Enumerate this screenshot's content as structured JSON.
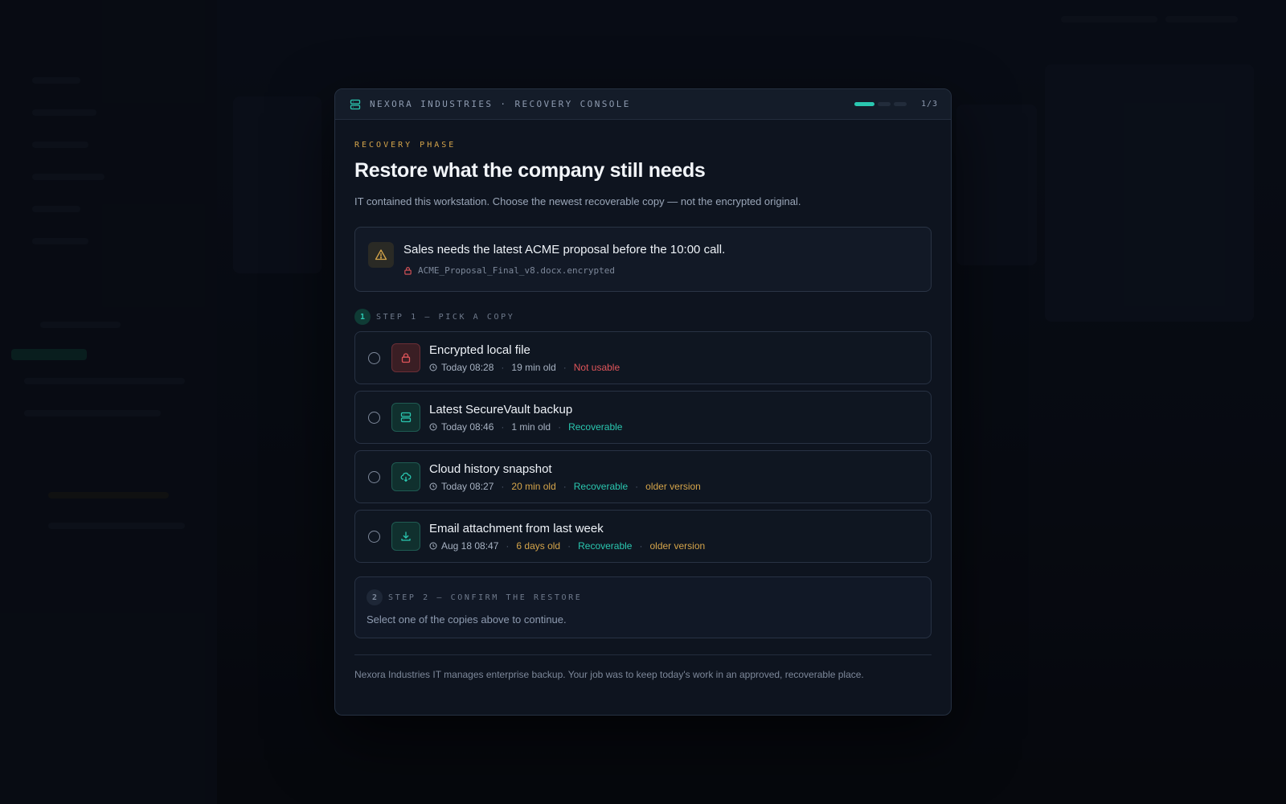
{
  "header": {
    "title": "NEXORA INDUSTRIES · RECOVERY CONSOLE",
    "step_counter": "1/3",
    "progress_segments": 3,
    "progress_active": 1
  },
  "phase_label": "RECOVERY PHASE",
  "title": "Restore what the company still needs",
  "subtitle": "IT contained this workstation. Choose the newest recoverable copy — not the encrypted original.",
  "alert": {
    "icon": "warning-icon",
    "message": "Sales needs the latest ACME proposal before the 10:00 call.",
    "file_icon": "lock-icon",
    "file_name": "ACME_Proposal_Final_v8.docx.encrypted"
  },
  "step1": {
    "number": "1",
    "label": "STEP 1 — PICK A COPY"
  },
  "options": [
    {
      "title": "Encrypted local file",
      "icon": "lock-icon",
      "time": "Today 08:28",
      "age": "19 min old",
      "status": "Not usable",
      "note": ""
    },
    {
      "title": "Latest SecureVault backup",
      "icon": "server-icon",
      "time": "Today 08:46",
      "age": "1 min old",
      "status": "Recoverable",
      "note": ""
    },
    {
      "title": "Cloud history snapshot",
      "icon": "cloud-icon",
      "time": "Today 08:27",
      "age": "20 min old",
      "status": "Recoverable",
      "note": "older version"
    },
    {
      "title": "Email attachment from last week",
      "icon": "download-icon",
      "time": "Aug 18 08:47",
      "age": "6 days old",
      "status": "Recoverable",
      "note": "older version"
    }
  ],
  "step2": {
    "number": "2",
    "label": "STEP 2 — CONFIRM THE RESTORE",
    "text": "Select one of the copies above to continue."
  },
  "footer": "Nexora Industries IT manages enterprise backup. Your job was to keep today's work in an approved, recoverable place.",
  "colors": {
    "accent": "#2ac7b0",
    "warning": "#d4a44a",
    "danger": "#e0555a",
    "background": "#0e141f"
  }
}
